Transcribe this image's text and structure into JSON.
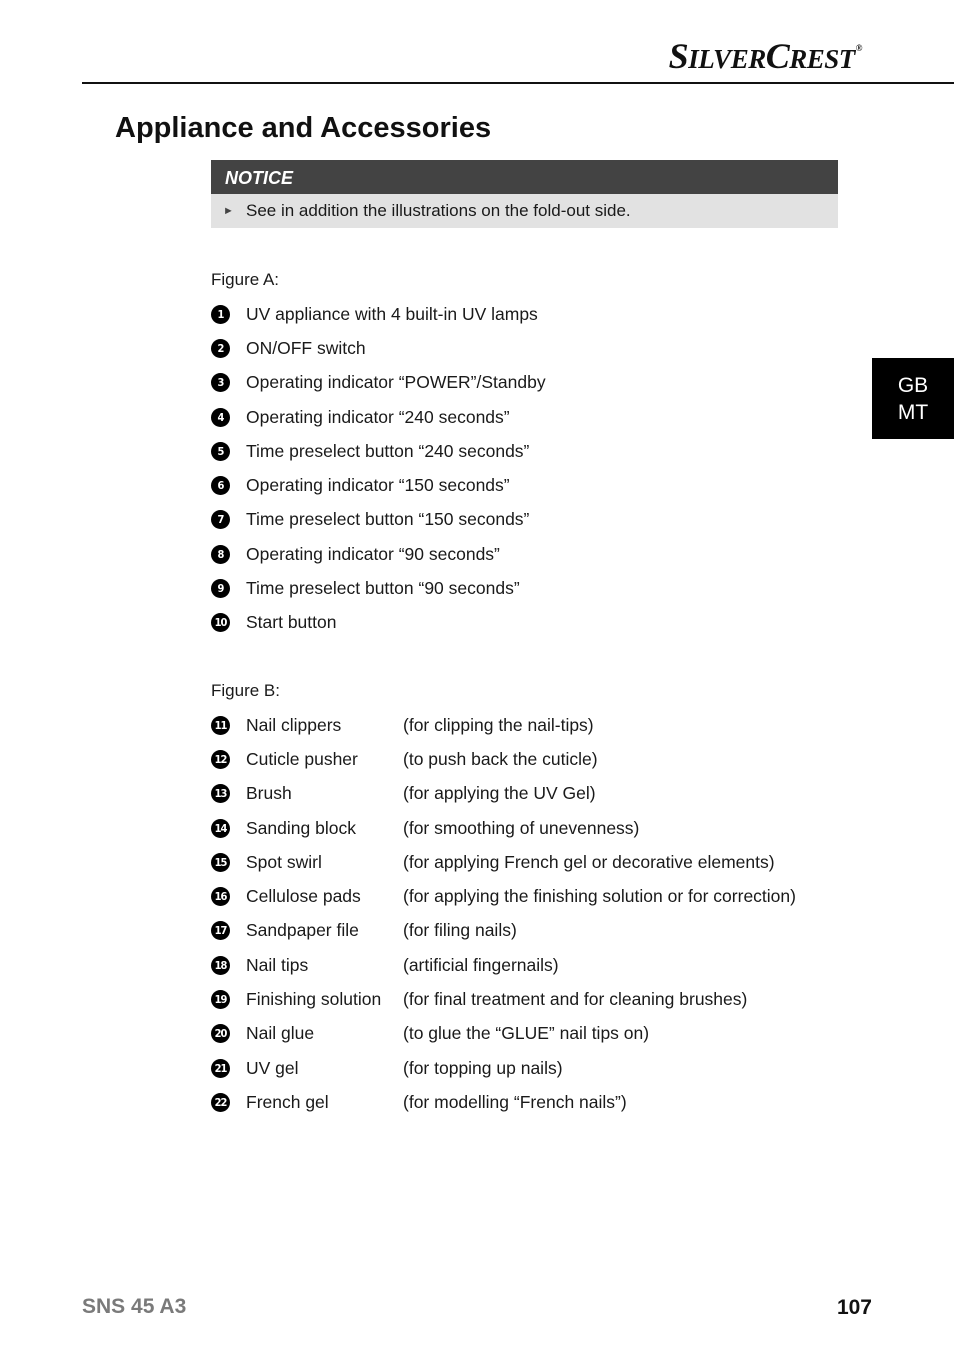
{
  "header": {
    "brand": {
      "part1_big": "S",
      "part1_small": "ILVER",
      "part2_big": "C",
      "part2_small": "REST",
      "registered": "®"
    }
  },
  "page_title": "Appliance and Accessories",
  "notice": {
    "title": "NOTICE",
    "bullet_icon": "triangle-right",
    "text": "See in addition the illustrations on the fold-out side."
  },
  "figure_a": {
    "label": "Figure A:",
    "items": [
      {
        "num": "1",
        "text": "UV appliance with 4 built-in UV lamps"
      },
      {
        "num": "2",
        "text": "ON/OFF switch"
      },
      {
        "num": "3",
        "text": "Operating indicator “POWER”/Standby"
      },
      {
        "num": "4",
        "text": "Operating indicator “240 seconds”"
      },
      {
        "num": "5",
        "text": "Time preselect button “240 seconds”"
      },
      {
        "num": "6",
        "text": "Operating indicator “150 seconds”"
      },
      {
        "num": "7",
        "text": "Time preselect button “150 seconds”"
      },
      {
        "num": "8",
        "text": "Operating indicator “90 seconds”"
      },
      {
        "num": "9",
        "text": "Time preselect button “90 seconds”"
      },
      {
        "num": "10",
        "text": "Start button"
      }
    ]
  },
  "figure_b": {
    "label": "Figure B:",
    "items": [
      {
        "num": "11",
        "name": "Nail clippers",
        "desc": "(for clipping the nail-tips)"
      },
      {
        "num": "12",
        "name": "Cuticle pusher",
        "desc": "(to push back the cuticle)"
      },
      {
        "num": "13",
        "name": "Brush",
        "desc": "(for applying the UV Gel)"
      },
      {
        "num": "14",
        "name": "Sanding block",
        "desc": "(for smoothing of unevenness)"
      },
      {
        "num": "15",
        "name": "Spot swirl",
        "desc": "(for applying French gel or decorative elements)"
      },
      {
        "num": "16",
        "name": "Cellulose pads",
        "desc": "(for applying the finishing solution or for correction)"
      },
      {
        "num": "17",
        "name": "Sandpaper file",
        "desc": "(for filing nails)"
      },
      {
        "num": "18",
        "name": "Nail tips",
        "desc": "(artificial fingernails)"
      },
      {
        "num": "19",
        "name": "Finishing solution",
        "desc": "(for final treatment and for cleaning brushes)"
      },
      {
        "num": "20",
        "name": "Nail glue",
        "desc": "(to glue the “GLUE” nail tips on)"
      },
      {
        "num": "21",
        "name": "UV gel",
        "desc": "(for topping up nails)"
      },
      {
        "num": "22",
        "name": "French gel",
        "desc": "(for modelling “French nails”)"
      }
    ]
  },
  "side_tab": {
    "line1": "GB",
    "line2": "MT"
  },
  "footer": {
    "model": "SNS 45 A3",
    "page_number": "107"
  }
}
